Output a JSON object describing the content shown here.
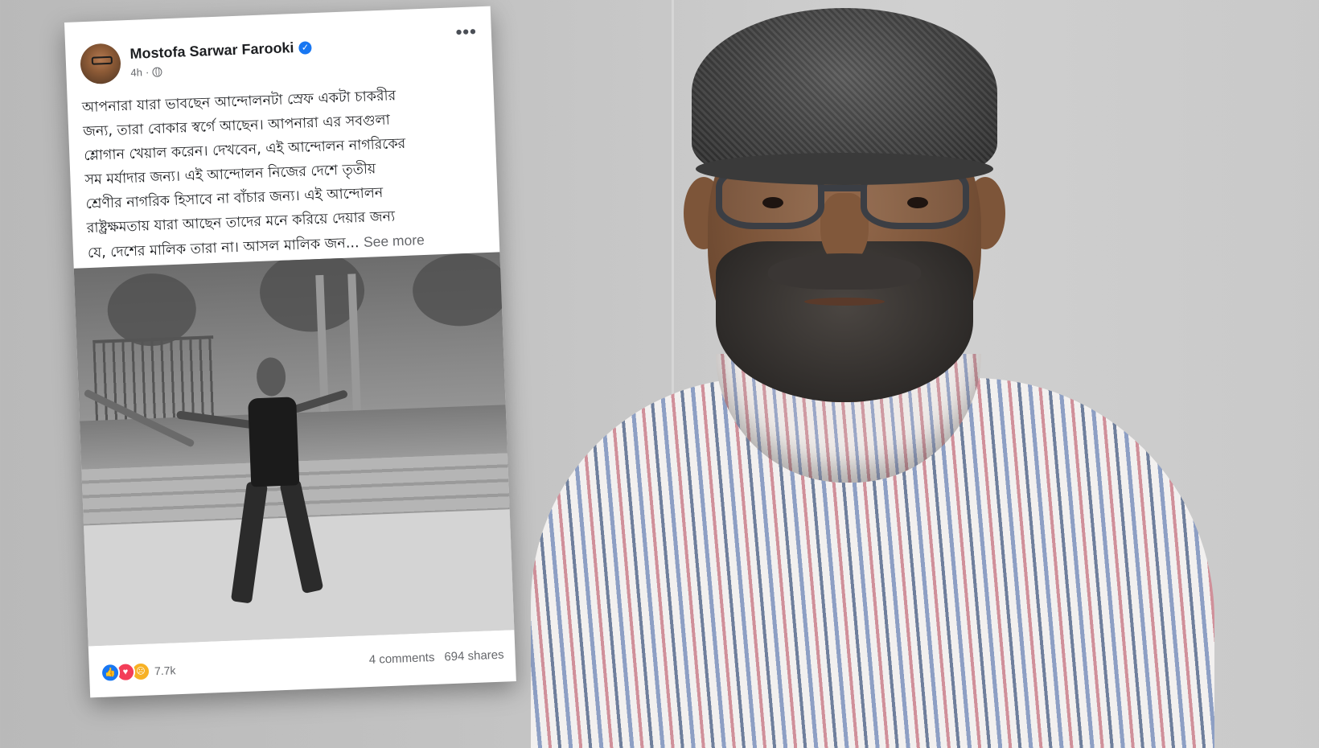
{
  "post": {
    "author": "Mostofa Sarwar Farooki",
    "time": "4h",
    "meta_separator": "·",
    "more_glyph": "•••",
    "verified_glyph": "✓",
    "text_lines": [
      "আপনারা যারা ভাবছেন আন্দোলনটা স্রেফ একটা চাকরীর",
      "জন্য, তারা বোকার স্বর্গে আছেন। আপনারা এর সবগুলা",
      "শ্লোগান খেয়াল করেন। দেখবেন, এই আন্দোলন নাগরিকের",
      "সম মর্যাদার জন্য। এই আন্দোলন নিজের দেশে তৃতীয়",
      "শ্রেণীর নাগরিক হিসাবে না বাঁচার জন্য। এই আন্দোলন",
      "রাষ্ট্রক্ষমতায় যারা আছেন তাদের মনে করিয়ে দেয়ার জন্য"
    ],
    "text_last_line": "যে, দেশের মালিক তারা না। আসল মালিক জন...",
    "see_more": "See more",
    "reactions": {
      "icons": [
        "like-icon",
        "love-icon",
        "sad-icon"
      ],
      "like_glyph": "👍",
      "love_glyph": "♥",
      "sad_glyph": "☹",
      "count": "7.7k"
    },
    "comments": "4 comments",
    "shares": "694 shares"
  }
}
